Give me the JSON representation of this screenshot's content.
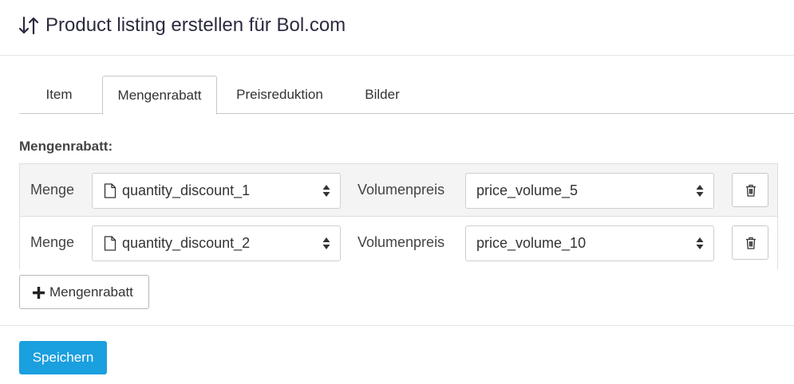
{
  "header": {
    "title": "Product listing erstellen für Bol.com",
    "icon": "sort-arrows-icon"
  },
  "tabs": [
    {
      "label": "Item",
      "active": false
    },
    {
      "label": "Mengenrabatt",
      "active": true
    },
    {
      "label": "Preisreduktion",
      "active": false
    },
    {
      "label": "Bilder",
      "active": false
    }
  ],
  "section": {
    "label": "Mengenrabatt:"
  },
  "rows": [
    {
      "menge_label": "Menge",
      "menge_value": "quantity_discount_1",
      "volumen_label": "Volumenpreis",
      "volumen_value": "price_volume_5"
    },
    {
      "menge_label": "Menge",
      "menge_value": "quantity_discount_2",
      "volumen_label": "Volumenpreis",
      "volumen_value": "price_volume_10"
    }
  ],
  "add_button": {
    "label": "Mengenrabatt",
    "icon": "plus-icon"
  },
  "save_button": {
    "label": "Speichern"
  },
  "colors": {
    "primary": "#1a9fdf",
    "title": "#2b2b40"
  }
}
